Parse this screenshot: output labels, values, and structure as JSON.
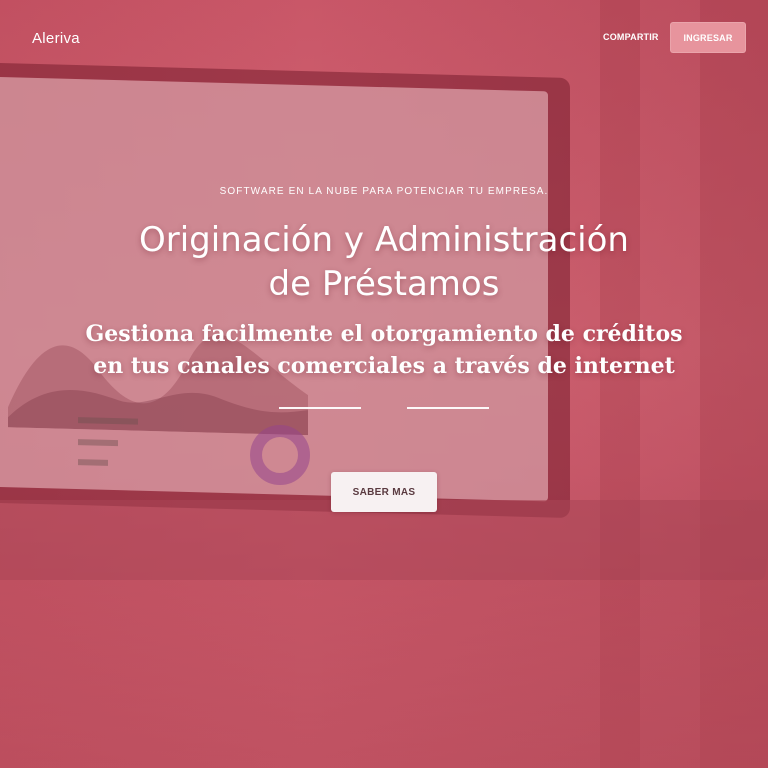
{
  "header": {
    "brand": "Aleriva",
    "share_label": "COMPARTIR",
    "login_label": "INGRESAR"
  },
  "hero": {
    "tagline": "SOFTWARE EN LA NUBE PARA POTENCIAR TU EMPRESA.",
    "title_line1": "Originación y Administración",
    "title_line2": "de Préstamos",
    "subtitle_line1": "Gestiona facilmente el otorgamiento de créditos",
    "subtitle_line2": "en tus canales comerciales a través de internet",
    "cta_label": "SABER MAS"
  },
  "colors": {
    "overlay": "#c95768",
    "login_button": "#e7949d",
    "cta_button": "#f7f1f2",
    "cta_text": "#5a3a40"
  }
}
